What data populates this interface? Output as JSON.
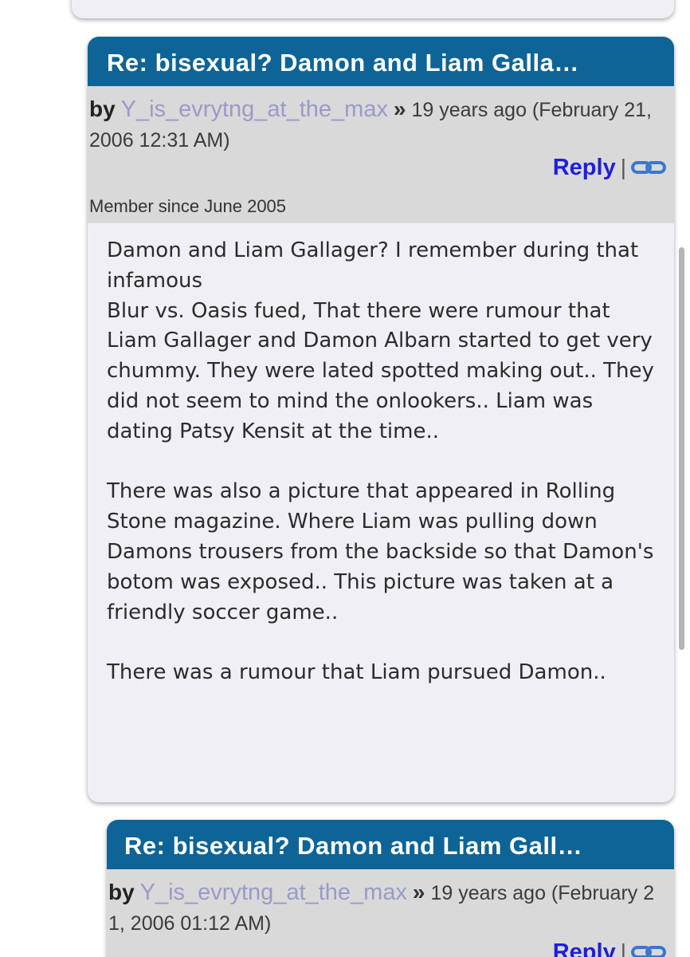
{
  "posts": [
    {
      "title": "Re: bisexual? Damon and Liam Galla…",
      "by_label": "by",
      "username": "Y_is_evrytng_at_the_max",
      "separator": "»",
      "timestamp": "19 years ago (February 21, 2006 12:31 AM)",
      "reply_label": "Reply",
      "member_since": "Member since June 2005",
      "body": "Damon and Liam Gallager? I remember during that infamous\nBlur vs. Oasis fued, That there were rumour that Liam Gallager and Damon Albarn started to get very chummy. They were lated spotted making out.. They did not seem to mind the onlookers.. Liam was dating Patsy Kensit at the time..\n\nThere was also a picture that appeared in Rolling Stone magazine. Where Liam was pulling down Damons trousers from the backside so that Damon's botom was exposed.. This picture was taken at a friendly soccer game..\n\nThere was a rumour that Liam pursued Damon.."
    },
    {
      "title": "Re: bisexual? Damon and Liam Gall…",
      "by_label": "by",
      "username": "Y_is_evrytng_at_the_max",
      "separator": "»",
      "timestamp": "19 years ago (February 21, 2006 01:12 AM)",
      "reply_label": "Reply"
    }
  ],
  "colors": {
    "header_bg": "#0e6496",
    "meta_bg": "#d9d9d9",
    "card_bg": "#f0eff5",
    "username": "#9a9ac8",
    "reply": "#1e1edc"
  },
  "icons": {
    "permalink": "link-icon"
  }
}
